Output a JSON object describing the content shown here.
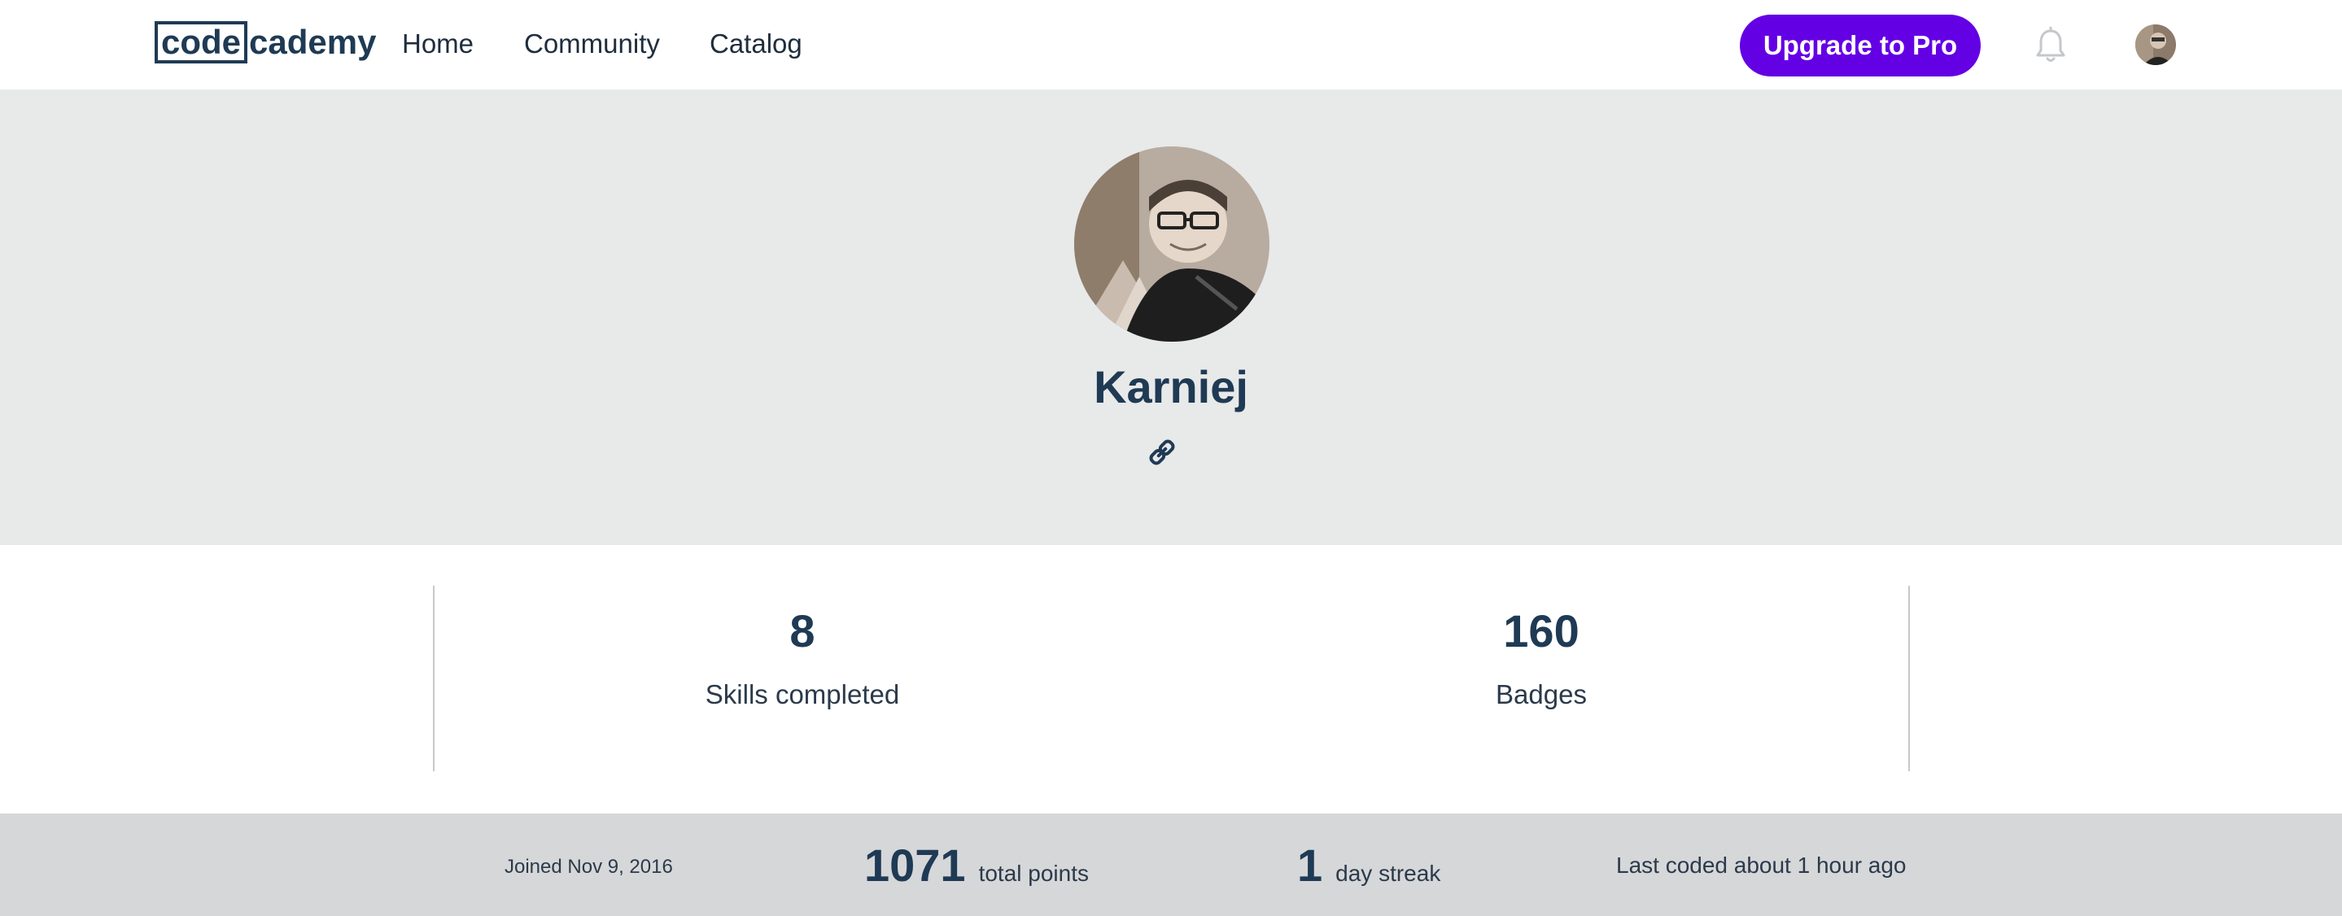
{
  "header": {
    "logo_box": "code",
    "logo_rest": "cademy",
    "nav": [
      {
        "label": "Home"
      },
      {
        "label": "Community"
      },
      {
        "label": "Catalog"
      }
    ],
    "upgrade_label": "Upgrade to Pro",
    "icons": [
      "bell-icon",
      "user-avatar"
    ]
  },
  "profile": {
    "username": "Karniej",
    "link_icon": "link-icon"
  },
  "stats": {
    "skills": {
      "value": "8",
      "label": "Skills completed"
    },
    "badges": {
      "value": "160",
      "label": "Badges"
    }
  },
  "footer": {
    "joined": "Joined Nov 9, 2016",
    "points_value": "1071",
    "points_label": "total points",
    "streak_value": "1",
    "streak_label": "day streak",
    "last_coded": "Last coded about 1 hour ago"
  },
  "colors": {
    "brand_navy": "#1f3a54",
    "upgrade_purple": "#6400e4",
    "hero_bg": "#e8e9e9",
    "footer_bg": "#d6d7d9"
  }
}
